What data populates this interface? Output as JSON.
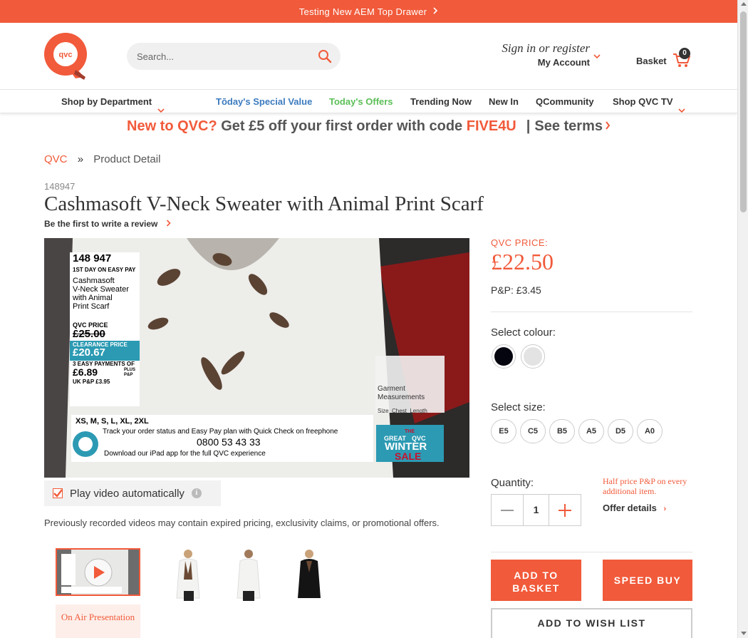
{
  "banner": {
    "text": "Testing New AEM Top Drawer"
  },
  "header": {
    "search_placeholder": "Search...",
    "sign_in": "Sign in or register",
    "my_account": "My Account",
    "basket_label": "Basket",
    "basket_count": "0"
  },
  "nav": {
    "items": [
      {
        "label": "Shop by Department"
      },
      {
        "label": "Tōday's Special Value"
      },
      {
        "label": "Today's Offers"
      },
      {
        "label": "Trending Now"
      },
      {
        "label": "New In"
      },
      {
        "label": "QCommunity"
      },
      {
        "label": "Shop QVC TV"
      }
    ]
  },
  "promo": {
    "lead": "New to QVC?",
    "middle": "Get £5 off your first order with code",
    "code": "FIVE4U",
    "terms": "See terms"
  },
  "breadcrumb": {
    "home": "QVC",
    "sep": "»",
    "current": "Product Detail"
  },
  "product": {
    "item_number": "148947",
    "title": "Cashmasoft V-Neck Sweater with Animal Print Scarf",
    "review_link": "Be the first to write a review",
    "price_label": "QVC PRICE:",
    "price": "£22.50",
    "pp": "P&P: £3.45",
    "colour_label": "Select colour:",
    "colours": [
      "#000000",
      "#e6e6e6"
    ],
    "size_label": "Select size:",
    "sizes": [
      "E5",
      "C5",
      "B5",
      "A5",
      "D5",
      "A0"
    ],
    "quantity_label": "Quantity:",
    "quantity": "1",
    "half_price_note": "Half price P&P on every additional item.",
    "offer_details": "Offer details",
    "add_to_basket": "ADD TO BASKET",
    "speed_buy": "SPEED BUY",
    "wish_list": "ADD TO WISH LIST"
  },
  "video": {
    "autoplay_label": "Play video automatically",
    "disclaimer": "Previously recorded videos may contain expired pricing, exclusivity claims, or promotional offers.",
    "on_air_label": "On Air Presentation",
    "overlay": {
      "number": "148 947",
      "easy_pay": "1ST DAY ON EASY PAY",
      "name_lines": [
        "Cashmasoft",
        "V-Neck Sweater",
        "with Animal",
        "Print Scarf"
      ],
      "qvc_price_label": "QVC PRICE",
      "old_price": "£25.00",
      "clearance_label": "CLEARANCE PRICE",
      "clearance_price": "£20.67",
      "easy_payments_label": "3 EASY PAYMENTS OF",
      "easy_payment": "£6.89",
      "plus_pp": "PLUS P&P",
      "uk_pp": "UK P&P £3.95",
      "sizes": "XS, M, S, L, XL, 2XL",
      "track": "Track your order status and Easy Pay plan with Quick Check on freephone",
      "phone": "0800 53 43 33",
      "ipad": "Download our iPad app for the full QVC experience",
      "garment": "Garment Measurements",
      "garment_cols": "Size  Chest  Length",
      "sale_the": "THE",
      "sale_great": "GREAT",
      "sale_brand": "QVC",
      "sale_winter": "WINTER",
      "sale_sale": "SALE"
    }
  },
  "colors": {
    "accent": "#f15a3a",
    "nav_blue": "#3b7bbf",
    "nav_green": "#5bbf57"
  }
}
